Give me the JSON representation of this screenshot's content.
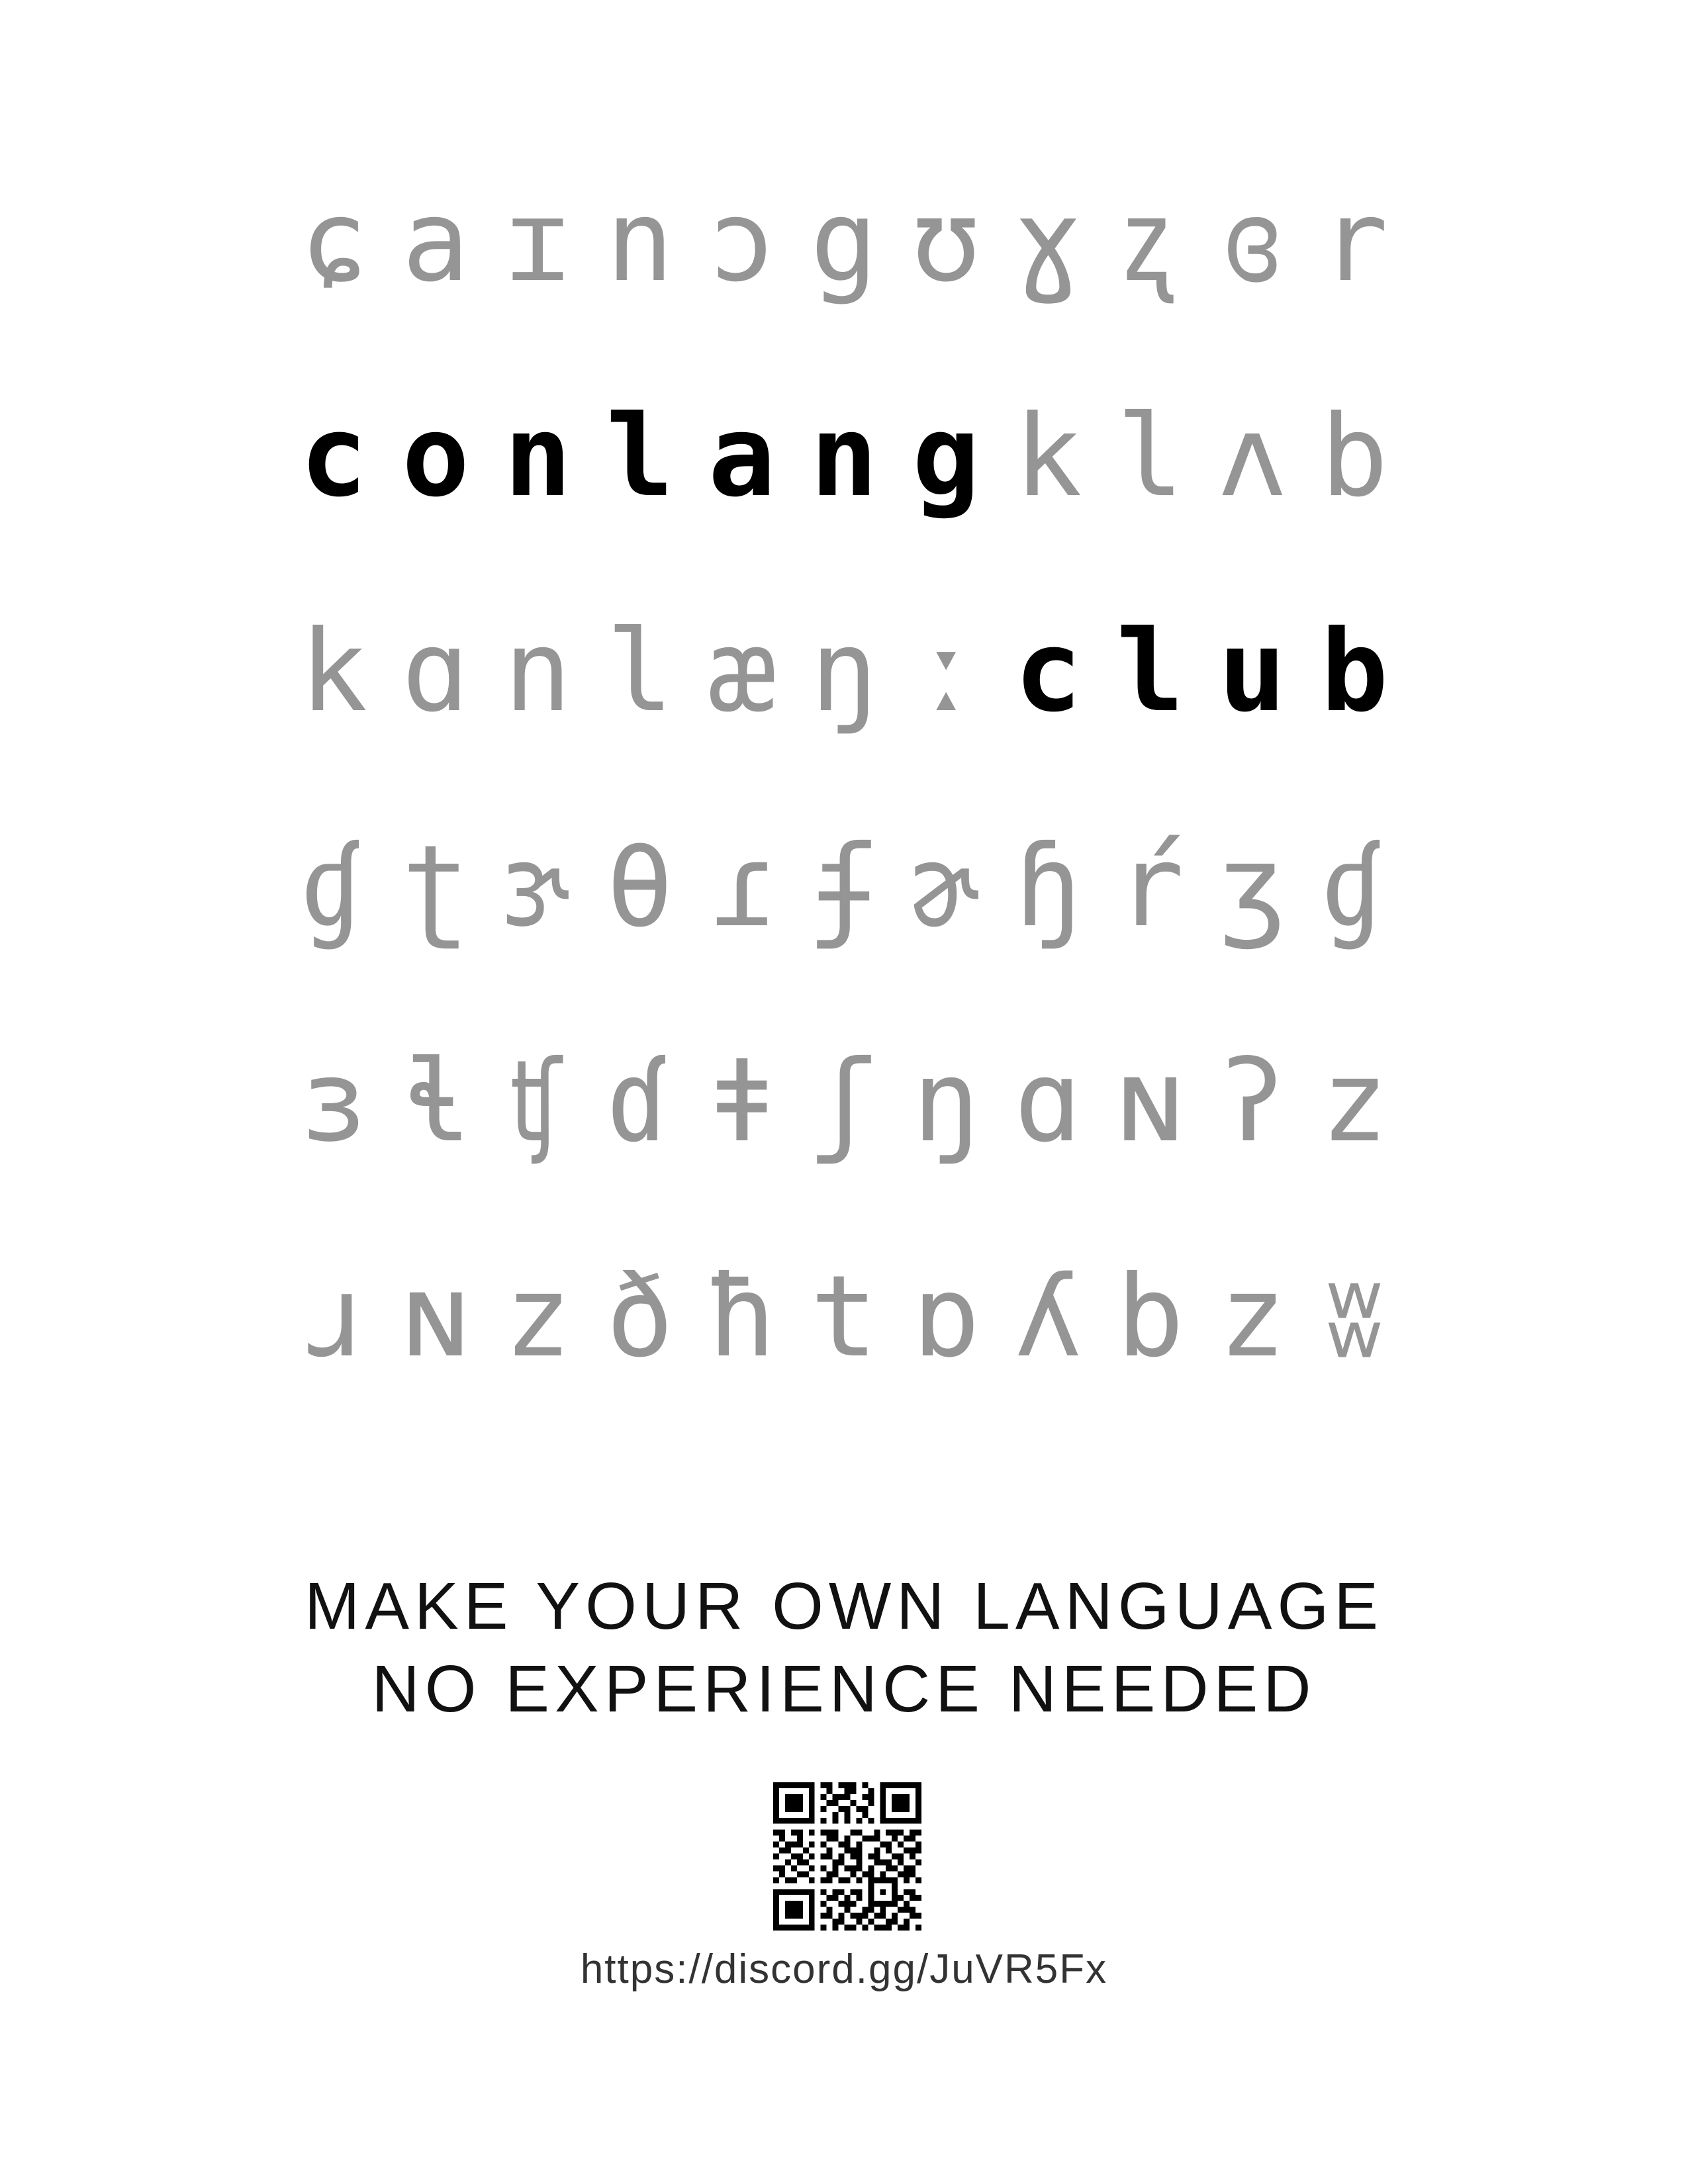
{
  "rows": [
    {
      "name": "ipa-row-1",
      "chars": [
        {
          "t": "ɕ",
          "hl": false
        },
        {
          "t": "a",
          "hl": false
        },
        {
          "t": "ɪ",
          "hl": false
        },
        {
          "t": "n",
          "hl": false
        },
        {
          "t": "ɔ",
          "hl": false
        },
        {
          "t": "g",
          "hl": false
        },
        {
          "t": "ʊ",
          "hl": false
        },
        {
          "t": "ɣ",
          "hl": false
        },
        {
          "t": "ʐ",
          "hl": false
        },
        {
          "t": "ɞ",
          "hl": false
        },
        {
          "t": "r",
          "hl": false
        }
      ]
    },
    {
      "name": "title-row-conlang",
      "chars": [
        {
          "t": "c",
          "hl": true
        },
        {
          "t": "o",
          "hl": true
        },
        {
          "t": "n",
          "hl": true
        },
        {
          "t": "l",
          "hl": true
        },
        {
          "t": "a",
          "hl": true
        },
        {
          "t": "n",
          "hl": true
        },
        {
          "t": "g",
          "hl": true
        },
        {
          "t": "k",
          "hl": false
        },
        {
          "t": "l",
          "hl": false
        },
        {
          "t": "ʌ",
          "hl": false
        },
        {
          "t": "b",
          "hl": false
        }
      ]
    },
    {
      "name": "title-row-club",
      "chars": [
        {
          "t": "k",
          "hl": false
        },
        {
          "t": "ɑ",
          "hl": false
        },
        {
          "t": "n",
          "hl": false
        },
        {
          "t": "l",
          "hl": false
        },
        {
          "t": "æ",
          "hl": false
        },
        {
          "t": "ŋ",
          "hl": false
        },
        {
          "t": "ː",
          "hl": false
        },
        {
          "t": "c",
          "hl": true
        },
        {
          "t": "l",
          "hl": true
        },
        {
          "t": "u",
          "hl": true
        },
        {
          "t": "b",
          "hl": true
        }
      ]
    },
    {
      "name": "ipa-row-4",
      "chars": [
        {
          "t": "ɠ",
          "hl": false
        },
        {
          "t": "ʈ",
          "hl": false
        },
        {
          "t": "ɝ",
          "hl": false
        },
        {
          "t": "θ",
          "hl": false
        },
        {
          "t": "ɾ",
          "hl": false
        },
        {
          "t": "ʄ",
          "hl": false
        },
        {
          "t": "ɚ",
          "hl": false
        },
        {
          "t": "ɧ",
          "hl": false
        },
        {
          "t": "ŕ",
          "hl": false
        },
        {
          "t": "ʒ",
          "hl": false
        },
        {
          "t": "ɠ",
          "hl": false
        }
      ]
    },
    {
      "name": "ipa-row-5",
      "chars": [
        {
          "t": "ɜ",
          "hl": false
        },
        {
          "t": "ɬ",
          "hl": false
        },
        {
          "t": "ʧ",
          "hl": false
        },
        {
          "t": "ɗ",
          "hl": false
        },
        {
          "t": "ǂ",
          "hl": false
        },
        {
          "t": "ʃ",
          "hl": false
        },
        {
          "t": "ŋ",
          "hl": false
        },
        {
          "t": "ɑ",
          "hl": false
        },
        {
          "t": "ɴ",
          "hl": false
        },
        {
          "t": "ʔ",
          "hl": false
        },
        {
          "t": "z",
          "hl": false
        }
      ]
    },
    {
      "name": "ipa-row-6",
      "chars": [
        {
          "t": "ɹ",
          "hl": false
        },
        {
          "t": "ɴ",
          "hl": false
        },
        {
          "t": "z",
          "hl": false
        },
        {
          "t": "ð",
          "hl": false
        },
        {
          "t": "ħ",
          "hl": false
        },
        {
          "t": "t",
          "hl": false
        },
        {
          "t": "ɒ",
          "hl": false
        },
        {
          "t": "ʎ",
          "hl": false
        },
        {
          "t": "b",
          "hl": false
        },
        {
          "t": "z",
          "hl": false
        },
        {
          "t": "ʬ",
          "hl": false
        }
      ]
    }
  ],
  "tagline": {
    "line1": "MAKE YOUR OWN LANGUAGE",
    "line2": "NO EXPERIENCE NEEDED"
  },
  "url": "https://discord.gg/JuVR5Fx",
  "colors": {
    "ipa_gray": "#959595",
    "highlight": "#000000"
  }
}
